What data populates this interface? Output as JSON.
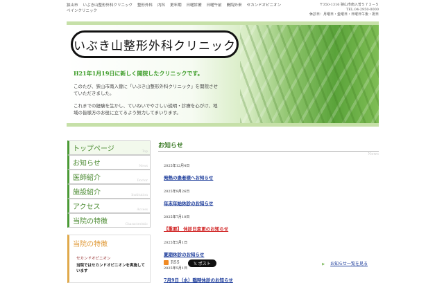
{
  "top": {
    "links": [
      "狭山市",
      "いぶき山整形外科クリニック",
      "整形外科",
      "内科",
      "更年期",
      "日曜診療",
      "日曜午前",
      "開院外来",
      "セカンドオピニオン",
      "ペインクリニック"
    ],
    "address": "〒350-1316 狭山市南入曽５７２－５",
    "tel": "TEL.04-2950-0000",
    "closed": "休診日：月曜日・金曜日・日曜日午後・祝日"
  },
  "hero": {
    "logo": "いぶき山整形外科クリニック",
    "tagline": "H21年1月19日に新しく開院したクリニックです。",
    "p1": "このたび、狭山市南入曽に「いぶき山整形外科クリニック」を開院させていただきました。",
    "p2": "これまでの経験を生かし、ていねいでやさしい説明・診療を心がけ、地域の皆様方のお役に立てるよう努力してまいります。"
  },
  "nav": [
    {
      "jp": "トップページ",
      "en": "Top"
    },
    {
      "jp": "お知らせ",
      "en": "News"
    },
    {
      "jp": "医師紹介",
      "en": "Doctor"
    },
    {
      "jp": "施設紹介",
      "en": "Institution"
    },
    {
      "jp": "アクセス",
      "en": "Access"
    },
    {
      "jp": "当院の特徴",
      "en": "Characteristic"
    }
  ],
  "feature": {
    "title": "当院の特徴",
    "sub": "セカンドオピニオン",
    "desc": "当院ではセカンドオピニオンを実施しています"
  },
  "news": {
    "title": "お知らせ",
    "en": "News",
    "items": [
      {
        "date": "2025年12月4日",
        "title": "発熱の患者様へお知らせ"
      },
      {
        "date": "2025年9月26日",
        "title": "年末年始休診のお知らせ"
      },
      {
        "date": "2025年7月10日",
        "title": "【重要】 休診日変更のお知らせ"
      },
      {
        "date": "2025年5月1日",
        "title": "夏期休診のお知らせ"
      },
      {
        "date": "2025年5月1日",
        "title": "7月9日（水）臨時休診のお知らせ"
      }
    ],
    "rss": "RSS",
    "post": "𝕏 ポスト",
    "more": "お知らせ一覧を見る"
  },
  "colors": {
    "accent": "#4a9a35",
    "important": "#d02020",
    "link": "#1a3a9a"
  }
}
